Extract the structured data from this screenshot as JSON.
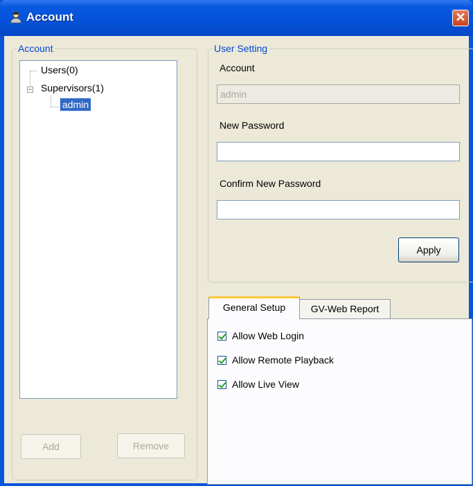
{
  "window": {
    "title": "Account"
  },
  "account_group": {
    "legend": "Account",
    "tree": {
      "users": "Users(0)",
      "supervisors": "Supervisors(1)",
      "supervisor_child": "admin"
    },
    "add_label": "Add",
    "remove_label": "Remove"
  },
  "user_setting": {
    "legend": "User Setting",
    "account_label": "Account",
    "account_value": "admin",
    "new_password_label": "New Password",
    "new_password_value": "",
    "confirm_password_label": "Confirm New Password",
    "confirm_password_value": "",
    "apply_label": "Apply"
  },
  "tabs": {
    "items": [
      {
        "label": "General Setup",
        "active": true
      },
      {
        "label": "GV-Web Report",
        "active": false
      }
    ],
    "general_setup": {
      "checks": [
        {
          "label": "Allow Web Login",
          "checked": true
        },
        {
          "label": "Allow Remote Playback",
          "checked": true
        },
        {
          "label": "Allow Live View",
          "checked": true
        }
      ]
    }
  }
}
